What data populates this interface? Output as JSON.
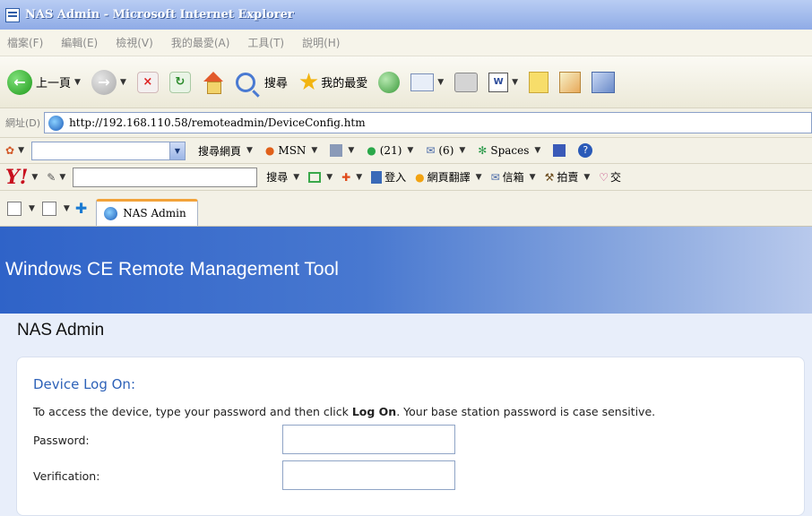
{
  "window": {
    "title": "NAS Admin - Microsoft Internet Explorer"
  },
  "menu": [
    "檔案(F)",
    "編輯(E)",
    "檢視(V)",
    "我的最愛(A)",
    "工具(T)",
    "說明(H)"
  ],
  "toolbar": {
    "back_label": "上一頁",
    "search_label": "搜尋",
    "favorites_label": "我的最愛"
  },
  "address": {
    "label": "網址(D)",
    "url": "http://192.168.110.58/remoteadmin/DeviceConfig.htm"
  },
  "links_bar": {
    "search_web_label": "搜尋網頁",
    "msn_label": "MSN",
    "buddy_count": "(21)",
    "mail_count": "(6)",
    "spaces_label": "Spaces"
  },
  "yahoo_bar": {
    "search_label": "搜尋",
    "login_label": "登入",
    "translate_label": "網頁翻譯",
    "mailbox_label": "信箱",
    "auction_label": "拍賣",
    "more_label": "交"
  },
  "tab": {
    "label": "NAS Admin"
  },
  "page": {
    "banner_title": "Windows CE Remote Management Tool",
    "section_title": "NAS Admin",
    "panel_heading": "Device Log On:",
    "desc_before": "To access the device, type your password and then click ",
    "desc_bold": "Log On",
    "desc_after": ". Your base station password is case sensitive.",
    "password_label": "Password:",
    "verification_label": "Verification:",
    "password_value": "",
    "verification_value": ""
  }
}
